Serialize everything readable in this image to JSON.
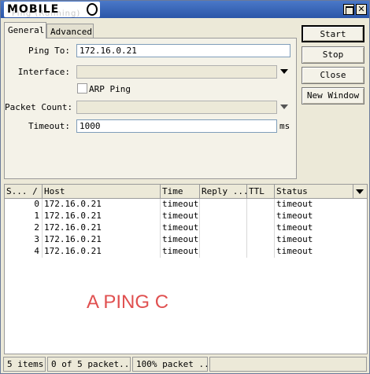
{
  "title_bar": {
    "logo_text": "MOBILE",
    "background_text": "Ping (Running)",
    "accent_color": "#2b56a8"
  },
  "tabs": [
    {
      "label": "General",
      "active": true
    },
    {
      "label": "Advanced",
      "active": false
    }
  ],
  "form": {
    "ping_to": {
      "label": "Ping To:",
      "value": "172.16.0.21"
    },
    "interface": {
      "label": "Interface:",
      "value": ""
    },
    "arp_ping": {
      "label": "ARP Ping",
      "checked": false
    },
    "packet_count": {
      "label": "Packet Count:",
      "value": ""
    },
    "timeout": {
      "label": "Timeout:",
      "value": "1000",
      "unit": "ms"
    }
  },
  "buttons": {
    "start": "Start",
    "stop": "Stop",
    "close": "Close",
    "new_window": "New Window"
  },
  "table": {
    "columns": [
      "S... /",
      "Host",
      "Time",
      "Reply ...",
      "TTL",
      "Status"
    ],
    "rows": [
      {
        "seq": "0",
        "host": "172.16.0.21",
        "time": "timeout",
        "reply": "",
        "ttl": "",
        "status": "timeout"
      },
      {
        "seq": "1",
        "host": "172.16.0.21",
        "time": "timeout",
        "reply": "",
        "ttl": "",
        "status": "timeout"
      },
      {
        "seq": "2",
        "host": "172.16.0.21",
        "time": "timeout",
        "reply": "",
        "ttl": "",
        "status": "timeout"
      },
      {
        "seq": "3",
        "host": "172.16.0.21",
        "time": "timeout",
        "reply": "",
        "ttl": "",
        "status": "timeout"
      },
      {
        "seq": "4",
        "host": "172.16.0.21",
        "time": "timeout",
        "reply": "",
        "ttl": "",
        "status": "timeout"
      }
    ]
  },
  "annotation": {
    "text": "A PING C",
    "color": "#e05050"
  },
  "status_bar": [
    "5 items",
    "0 of 5 packet...",
    "100% packet ..."
  ]
}
